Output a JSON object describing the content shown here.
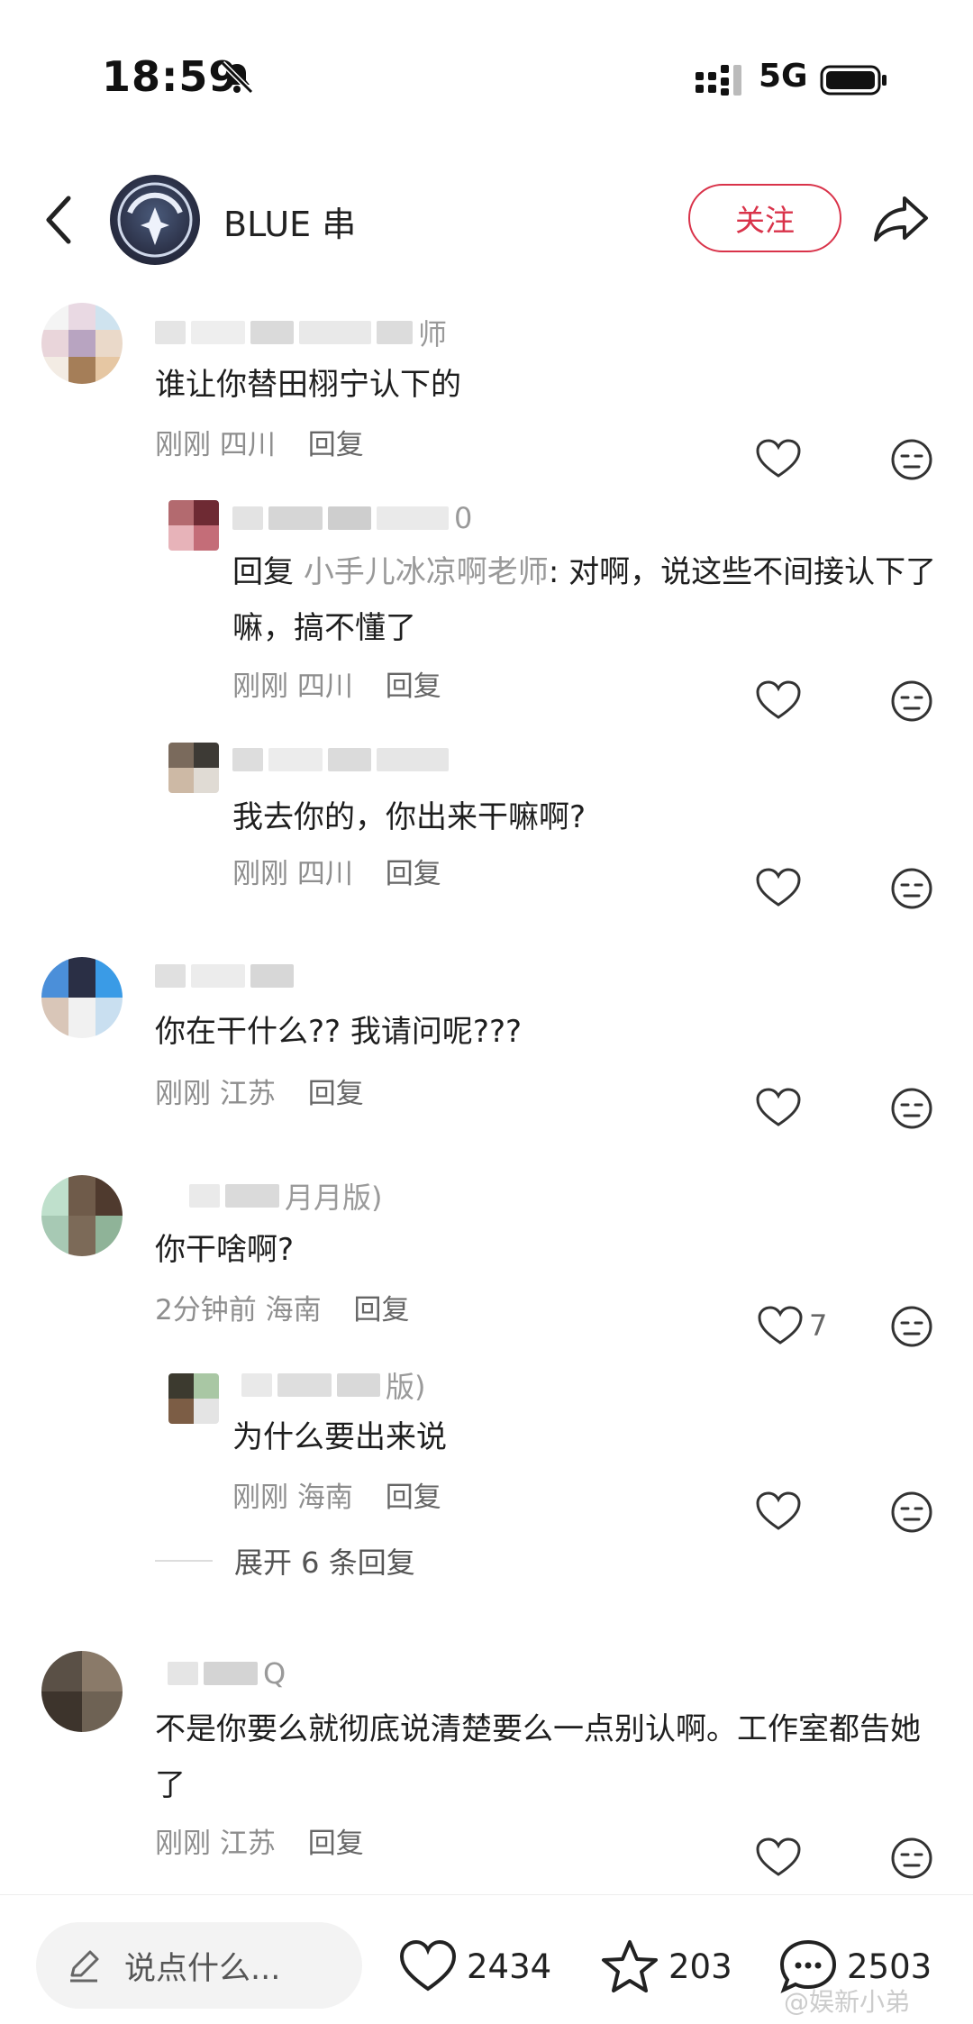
{
  "status_bar": {
    "time": "18:59",
    "network": "5G"
  },
  "header": {
    "channel_name": "BLUE 串",
    "follow_label": "关注"
  },
  "comments": [
    {
      "name_tail": "师",
      "text": "谁让你替田栩宁认下的",
      "time": "刚刚",
      "location": "四川",
      "reply_label": "回复",
      "avatar_colors": [
        "#f4f4f4",
        "#e9d9e3",
        "#cfe3ef",
        "#e9d5da",
        "#b8a4c1",
        "#ead9c9",
        "#f3ece4",
        "#a57e58",
        "#e6c7a3"
      ],
      "name_colors": [
        "#dcdcdc",
        "#e8e8e8",
        "#cdcdcd",
        "#e2e2e2",
        "#d0d0d0"
      ]
    },
    {
      "name_tail": "0",
      "reply_prefix": "回复",
      "reply_to": "小手儿冰凉啊老师",
      "text": ": 对啊，说这些不间接认下了嘛，搞不懂了",
      "time": "刚刚",
      "location": "四川",
      "reply_label": "回复",
      "avatar_colors": [
        "#b36a6f",
        "#6e2a33",
        "#e7b3b9",
        "#c46d78"
      ],
      "name_colors": [
        "#d9d9d9",
        "#c8c8c8",
        "#bdbdbd",
        "#e3e3e3"
      ]
    },
    {
      "name_tail": "",
      "text": "我去你的，你出来干嘛啊?",
      "time": "刚刚",
      "location": "四川",
      "reply_label": "回复",
      "avatar_colors": [
        "#7a6a5c",
        "#3d3a35",
        "#cdb9a5",
        "#e0dbd4"
      ],
      "name_colors": [
        "#d2d2d2",
        "#e5e5e5",
        "#cfcfcf",
        "#dedede"
      ]
    },
    {
      "name_tail": "",
      "text": "你在干什么?? 我请问呢???",
      "time": "刚刚",
      "location": "江苏",
      "reply_label": "回复",
      "avatar_colors": [
        "#4b8fd9",
        "#2a2f45",
        "#3a9be6",
        "#d9c6b8",
        "#f1f1f1",
        "#c9dff0"
      ],
      "name_colors": [
        "#d6d6d6",
        "#e6e6e6",
        "#cacaca"
      ]
    },
    {
      "name_tail": "月月版)",
      "text": "你干啥啊?",
      "time": "2分钟前",
      "location": "海南",
      "reply_label": "回复",
      "like_count": "7",
      "avatar_colors": [
        "#bfe0cc",
        "#6f5b4a",
        "#4f3a2e",
        "#a7c9b4",
        "#7c6a58",
        "#8fb398"
      ],
      "name_colors": [
        "#e3e3e3",
        "#cdcdcd"
      ]
    },
    {
      "name_tail": "版)",
      "text": "为什么要出来说",
      "time": "刚刚",
      "location": "海南",
      "reply_label": "回复",
      "avatar_colors": [
        "#3c3a2f",
        "#a9c7a4",
        "#7c5d45",
        "#e4e4e4"
      ],
      "name_colors": [
        "#e1e1e1",
        "#d3d3d3",
        "#cccccc"
      ]
    },
    {
      "name_tail": "Q",
      "text": "不是你要么就彻底说清楚要么一点别认啊。工作室都告她了",
      "time": "刚刚",
      "location": "江苏",
      "reply_label": "回复",
      "avatar_colors": [
        "#5a5046",
        "#8a7a69",
        "#3d342c",
        "#6e6254"
      ],
      "name_colors": [
        "#dcdcdc",
        "#c6c6c6"
      ]
    }
  ],
  "expand_label": "展开 6 条回复",
  "bottom_bar": {
    "input_placeholder": "说点什么...",
    "likes": "2434",
    "favorites": "203",
    "comments": "2503"
  },
  "watermark": "@娱新小弟",
  "colors": {
    "accent": "#d9334a",
    "meta_gray": "#8e8e8e",
    "reply_link": "#999999"
  },
  "icons": [
    "back-icon",
    "share-icon",
    "heart-icon",
    "meh-face-icon",
    "pencil-icon",
    "star-icon",
    "chat-bubble-icon",
    "bell-mute-icon",
    "signal-icon",
    "battery-icon"
  ]
}
